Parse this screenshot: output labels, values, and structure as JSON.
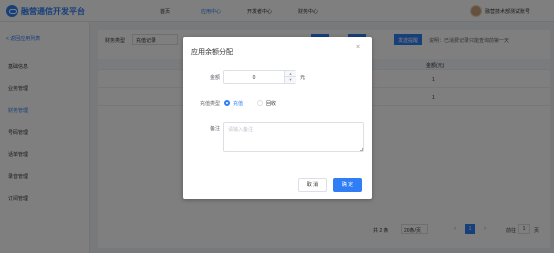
{
  "topbar": {
    "brand": "融营通信开发平台",
    "nav": [
      "首页",
      "应用中心",
      "开发者中心",
      "财务中心"
    ],
    "active_nav_index": 1,
    "user": "融营技术部测试账号"
  },
  "sidebar": {
    "back": "< 返回应用列表",
    "items": [
      "基础信息",
      "业务管理",
      "财务管理",
      "号码管理",
      "话单管理",
      "录音管理",
      "订阅管理"
    ],
    "active_index": 2
  },
  "main": {
    "filter_label": "财务类型",
    "filter_value": "充值记录",
    "buttons": [
      "查询",
      "充值",
      "发送提醒"
    ],
    "note": "说明：已消费记录只能查询前第一天",
    "amount_header": "金额(元)",
    "rows": [
      "1",
      "1"
    ],
    "pagination": {
      "total": "共 2 条",
      "page_size": "20条/页",
      "current_page": "1",
      "goto_label": "前往",
      "goto_value": "1",
      "goto_unit": "页"
    }
  },
  "dialog": {
    "title": "应用余额分配",
    "close": "×",
    "amount_label": "金额",
    "amount_value": "0",
    "amount_unit": "元",
    "type_label": "充值类型",
    "type_options": [
      "充值",
      "回收"
    ],
    "type_selected_index": 0,
    "remark_label": "备注",
    "remark_placeholder": "请输入备注",
    "cancel": "取 消",
    "confirm": "确 定"
  },
  "colors": {
    "primary": "#2f7ef5",
    "overlay": "rgba(0,0,0,0.5)",
    "border": "#dcdfe6"
  }
}
